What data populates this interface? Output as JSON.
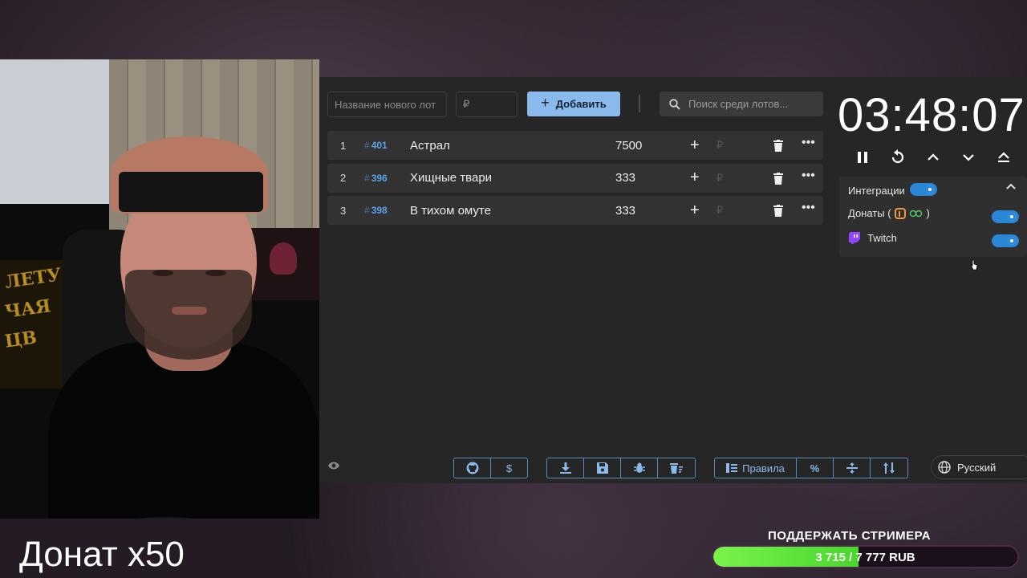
{
  "toolbar": {
    "new_lot_placeholder": "Название нового лот",
    "price_placeholder": "₽",
    "add_label": "Добавить",
    "search_placeholder": "Поиск среди лотов..."
  },
  "lots": [
    {
      "num": "1",
      "id": "401",
      "name": "Астрал",
      "amount": "7500"
    },
    {
      "num": "2",
      "id": "396",
      "name": "Хищные твари",
      "amount": "333"
    },
    {
      "num": "3",
      "id": "398",
      "name": "В тихом омуте",
      "amount": "333"
    }
  ],
  "lot_hash": "#",
  "lot_rub": "₽",
  "timer": "03:48:07",
  "integrations": {
    "title": "Интеграции",
    "donations_label": "Донаты (",
    "donations_close": ")",
    "twitch_label": "Twitch"
  },
  "bottom": {
    "rules_label": "Правила",
    "dollar": "$",
    "percent": "%",
    "language": "Русский"
  },
  "overlay": {
    "donate_text": "Донат х50",
    "support_title": "ПОДДЕРЖАТЬ СТРИМЕРА",
    "progress_text": "3 715 / 7 777 RUB",
    "progress_fraction": 0.478
  },
  "colors": {
    "accent": "#8ab9ec",
    "toggle": "#2a86d6",
    "progress": "#5ee63a",
    "twitch": "#9146ff"
  }
}
